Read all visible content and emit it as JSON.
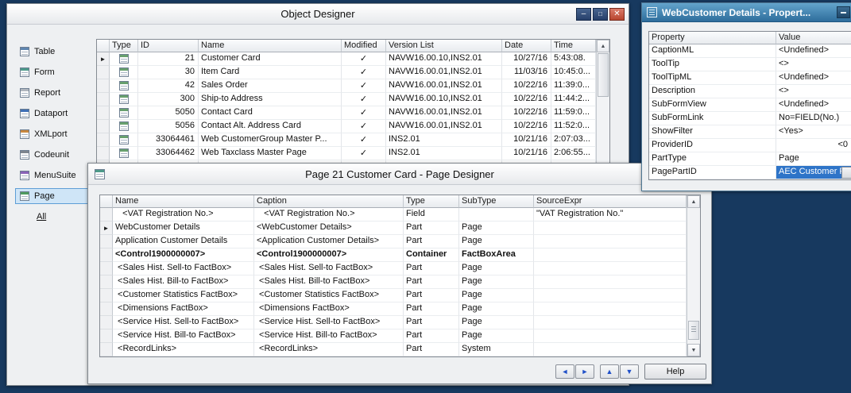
{
  "colors": {
    "desktop_navy": "#17395f",
    "properties_titlebar_teal": "#3b85b8",
    "selection_blue": "#2e74c8",
    "close_button_red": "#b8452f",
    "nav_arrow_blue": "#2050c8",
    "sidebar_selected_blue": "#cfe5f7"
  },
  "icons": {
    "scroll_up": "▲",
    "scroll_down": "▼"
  },
  "object_designer": {
    "title": "Object Designer",
    "window_buttons": {
      "minimize": "–",
      "maximize": "□",
      "close": "✕"
    },
    "sidebar": {
      "items": [
        {
          "label": "Table"
        },
        {
          "label": "Form"
        },
        {
          "label": "Report"
        },
        {
          "label": "Dataport"
        },
        {
          "label": "XMLport"
        },
        {
          "label": "Codeunit"
        },
        {
          "label": "MenuSuite"
        },
        {
          "label": "Page"
        },
        {
          "label": "All"
        }
      ],
      "selected": "Page"
    },
    "grid": {
      "columns": [
        "",
        "Type",
        "ID",
        "Name",
        "Modified",
        "Version List",
        "Date",
        "Time"
      ],
      "rows": [
        {
          "marker": "►",
          "id": "21",
          "name": "Customer Card",
          "modified": "✓",
          "version": "NAVW16.00.10,INS2.01",
          "date": "10/27/16",
          "time": "5:43:08."
        },
        {
          "marker": "",
          "id": "30",
          "name": "Item Card",
          "modified": "✓",
          "version": "NAVW16.00.01,INS2.01",
          "date": "11/03/16",
          "time": "10:45:0..."
        },
        {
          "marker": "",
          "id": "42",
          "name": "Sales Order",
          "modified": "✓",
          "version": "NAVW16.00.01,INS2.01",
          "date": "10/22/16",
          "time": "11:39:0..."
        },
        {
          "marker": "",
          "id": "300",
          "name": "Ship-to Address",
          "modified": "✓",
          "version": "NAVW16.00.10,INS2.01",
          "date": "10/22/16",
          "time": "11:44:2..."
        },
        {
          "marker": "",
          "id": "5050",
          "name": "Contact Card",
          "modified": "✓",
          "version": "NAVW16.00.01,INS2.01",
          "date": "10/22/16",
          "time": "11:59:0..."
        },
        {
          "marker": "",
          "id": "5056",
          "name": "Contact Alt. Address Card",
          "modified": "✓",
          "version": "NAVW16.00.01,INS2.01",
          "date": "10/22/16",
          "time": "11:52:0..."
        },
        {
          "marker": "",
          "id": "33064461",
          "name": "Web CustomerGroup Master P...",
          "modified": "✓",
          "version": "INS2.01",
          "date": "10/21/16",
          "time": "2:07:03..."
        },
        {
          "marker": "",
          "id": "33064462",
          "name": "Web Taxclass Master Page",
          "modified": "✓",
          "version": "INS2.01",
          "date": "10/21/16",
          "time": "2:06:55..."
        }
      ]
    }
  },
  "page_designer": {
    "title": "Page 21 Customer Card - Page Designer",
    "grid": {
      "columns": [
        "",
        "Name",
        "Caption",
        "Type",
        "SubType",
        "SourceExpr"
      ],
      "rows": [
        {
          "marker": "",
          "name": "   <VAT Registration No.>",
          "caption": "   <VAT Registration No.>",
          "type": "Field",
          "subtype": "",
          "source": "\"VAT Registration No.\""
        },
        {
          "marker": "►",
          "name": "WebCustomer Details",
          "caption": "<WebCustomer Details>",
          "type": "Part",
          "subtype": "Page",
          "source": ""
        },
        {
          "marker": "",
          "name": "Application Customer Details",
          "caption": "<Application Customer Details>",
          "type": "Part",
          "subtype": "Page",
          "source": ""
        },
        {
          "marker": "",
          "name": "<Control1900000007>",
          "caption": "<Control1900000007>",
          "type": "Container",
          "subtype": "FactBoxArea",
          "source": ""
        },
        {
          "marker": "",
          "name": " <Sales Hist. Sell-to FactBox>",
          "caption": " <Sales Hist. Sell-to FactBox>",
          "type": "Part",
          "subtype": "Page",
          "source": ""
        },
        {
          "marker": "",
          "name": " <Sales Hist. Bill-to FactBox>",
          "caption": " <Sales Hist. Bill-to FactBox>",
          "type": "Part",
          "subtype": "Page",
          "source": ""
        },
        {
          "marker": "",
          "name": " <Customer Statistics FactBox>",
          "caption": " <Customer Statistics FactBox>",
          "type": "Part",
          "subtype": "Page",
          "source": ""
        },
        {
          "marker": "",
          "name": " <Dimensions FactBox>",
          "caption": " <Dimensions FactBox>",
          "type": "Part",
          "subtype": "Page",
          "source": ""
        },
        {
          "marker": "",
          "name": " <Service Hist. Sell-to FactBox>",
          "caption": " <Service Hist. Sell-to FactBox>",
          "type": "Part",
          "subtype": "Page",
          "source": ""
        },
        {
          "marker": "",
          "name": " <Service Hist. Bill-to FactBox>",
          "caption": " <Service Hist. Bill-to FactBox>",
          "type": "Part",
          "subtype": "Page",
          "source": ""
        },
        {
          "marker": "",
          "name": " <RecordLinks>",
          "caption": " <RecordLinks>",
          "type": "Part",
          "subtype": "System",
          "source": ""
        }
      ]
    },
    "nav_buttons": {
      "left": "◄",
      "right": "►",
      "up": "▲",
      "down": "▼"
    },
    "help_label": "Help"
  },
  "properties": {
    "title": "WebCustomer Details - Propert...",
    "columns": [
      "Property",
      "Value"
    ],
    "rows": [
      {
        "property": "CaptionML",
        "value": "<Undefined>"
      },
      {
        "property": "ToolTip",
        "value": "<>"
      },
      {
        "property": "ToolTipML",
        "value": "<Undefined>"
      },
      {
        "property": "Description",
        "value": "<>"
      },
      {
        "property": "SubFormView",
        "value": "<Undefined>"
      },
      {
        "property": "SubFormLink",
        "value": "No=FIELD(No.)"
      },
      {
        "property": "ShowFilter",
        "value": "<Yes>"
      },
      {
        "property": "ProviderID",
        "value": "<0"
      },
      {
        "property": "PartType",
        "value": "Page"
      },
      {
        "property": "PagePartID",
        "value": "AEC Customer P"
      }
    ]
  }
}
